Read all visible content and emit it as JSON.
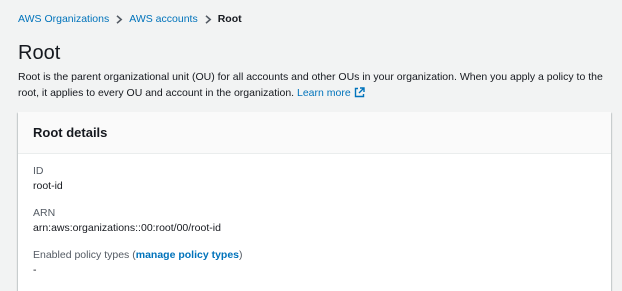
{
  "breadcrumb": {
    "items": [
      "AWS Organizations",
      "AWS accounts"
    ],
    "current": "Root"
  },
  "page": {
    "title": "Root",
    "description": "Root is the parent organizational unit (OU) for all accounts and other OUs in your organization. When you apply a policy to the root, it applies to every OU and account in the organization.",
    "learn_more": "Learn more"
  },
  "details": {
    "header": "Root details",
    "id_label": "ID",
    "id_value": "root-id",
    "arn_label": "ARN",
    "arn_value": "arn:aws:organizations::00:root/00/root-id",
    "policy_label_prefix": "Enabled policy types (",
    "policy_link": "manage policy types",
    "policy_label_suffix": ")",
    "policy_value": "-"
  },
  "icons": {
    "breadcrumb_separator": "chevron-right-icon",
    "external_link": "external-link-icon"
  },
  "colors": {
    "link": "#0073bb",
    "background": "#f2f3f3",
    "text": "#16191f"
  }
}
